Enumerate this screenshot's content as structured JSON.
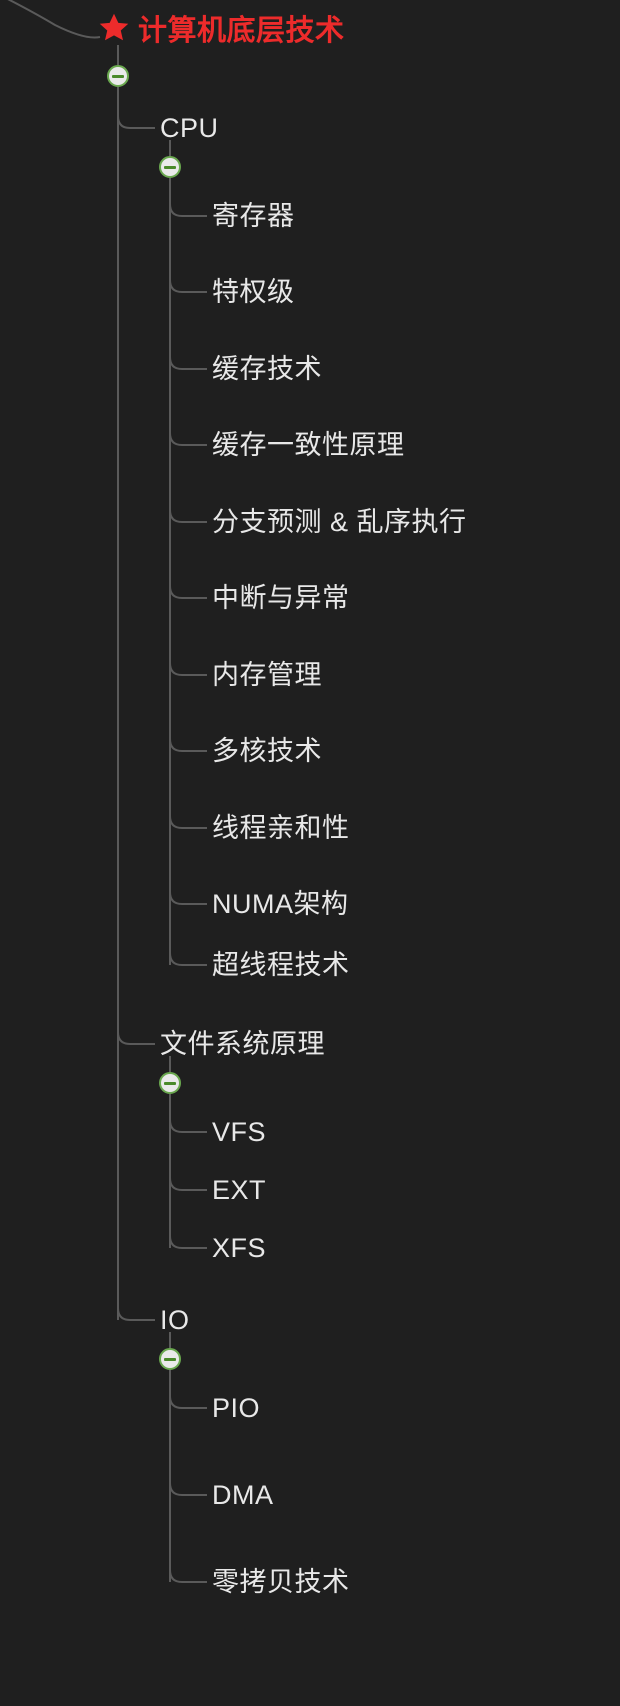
{
  "colors": {
    "bg": "#1f1f1f",
    "line": "#5a5a5a",
    "text": "#e8e8e8",
    "root": "#ed2b2b",
    "toggle_border": "#6aa84f",
    "toggle_fill": "#eaeaea",
    "toggle_bar": "#4a8a2a"
  },
  "root": {
    "label": "计算机底层技术",
    "icon": "star-icon"
  },
  "nodes": {
    "cpu": {
      "label": "CPU",
      "children": [
        "寄存器",
        "特权级",
        "缓存技术",
        "缓存一致性原理",
        "分支预测 & 乱序执行",
        "中断与异常",
        "内存管理",
        "多核技术",
        "线程亲和性",
        "NUMA架构",
        "超线程技术"
      ]
    },
    "fs": {
      "label": "文件系统原理",
      "children": [
        "VFS",
        "EXT",
        "XFS"
      ]
    },
    "io": {
      "label": "IO",
      "children": [
        "PIO",
        "DMA",
        "零拷贝技术"
      ]
    }
  }
}
